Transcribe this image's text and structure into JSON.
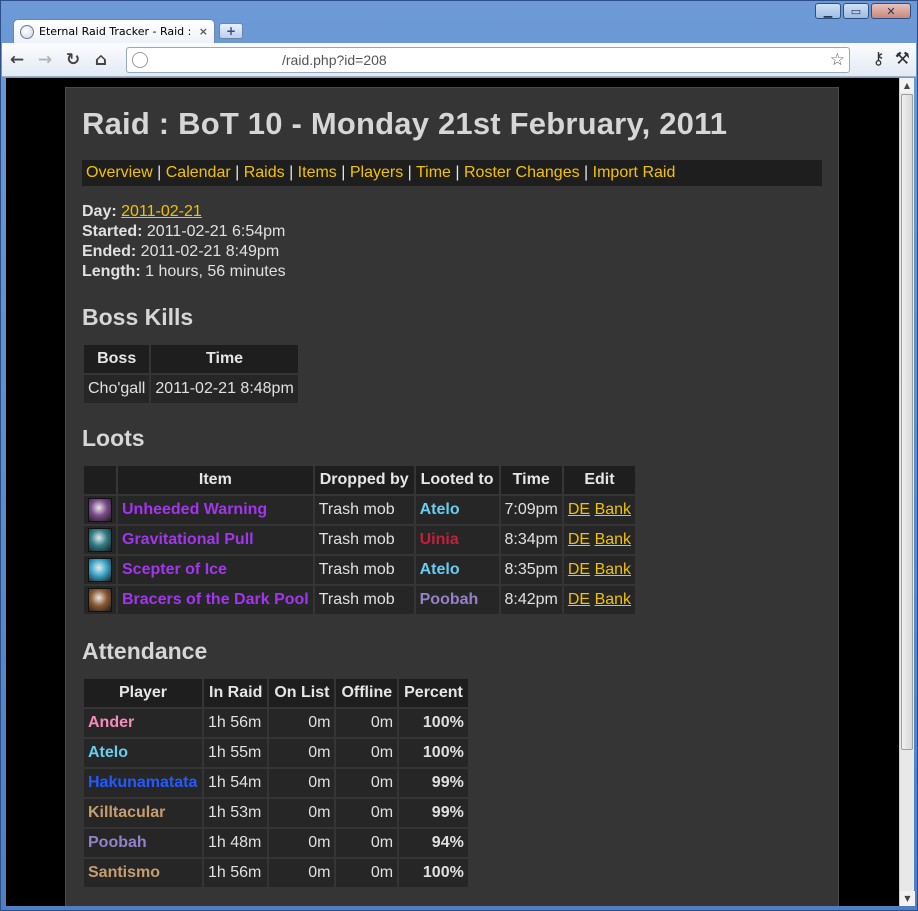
{
  "browser": {
    "tab_title": "Eternal Raid Tracker - Raid : BoT",
    "tab_close": "×",
    "new_tab": "+",
    "url": "/raid.php?id=208",
    "window_controls": [
      "▁",
      "▭",
      "✕"
    ]
  },
  "page": {
    "title": "Raid : BoT 10 - Monday 21st February, 2011",
    "nav": [
      "Overview",
      "Calendar",
      "Raids",
      "Items",
      "Players",
      "Time",
      "Roster Changes",
      "Import Raid"
    ],
    "info": {
      "day_label": "Day:",
      "day_value": "2011-02-21",
      "started_label": "Started:",
      "started_value": "2011-02-21 6:54pm",
      "ended_label": "Ended:",
      "ended_value": "2011-02-21 8:49pm",
      "length_label": "Length:",
      "length_value": "1 hours, 56 minutes"
    },
    "boss_kills": {
      "heading": "Boss Kills",
      "headers": [
        "Boss",
        "Time"
      ],
      "rows": [
        {
          "boss": "Cho'gall",
          "time": "2011-02-21 8:48pm"
        }
      ]
    },
    "loots": {
      "heading": "Loots",
      "headers": [
        "Item",
        "Dropped by",
        "Looted to",
        "Time",
        "Edit"
      ],
      "rows": [
        {
          "icon": "warning-icon",
          "icon_color": "#7a4a8a",
          "item": "Unheeded Warning",
          "dropped_by": "Trash mob",
          "looted_to": "Atelo",
          "looter_color": "#69ccf0",
          "time": "7:09pm",
          "de": "DE",
          "bank": "Bank"
        },
        {
          "icon": "pull-icon",
          "icon_color": "#2f7d86",
          "item": "Gravitational Pull",
          "dropped_by": "Trash mob",
          "looted_to": "Uinia",
          "looter_color": "#c41f3b",
          "time": "8:34pm",
          "de": "DE",
          "bank": "Bank"
        },
        {
          "icon": "scepter-icon",
          "icon_color": "#3aa6c9",
          "item": "Scepter of Ice",
          "dropped_by": "Trash mob",
          "looted_to": "Atelo",
          "looter_color": "#69ccf0",
          "time": "8:35pm",
          "de": "DE",
          "bank": "Bank"
        },
        {
          "icon": "bracers-icon",
          "icon_color": "#8a5a34",
          "item": "Bracers of the Dark Pool",
          "dropped_by": "Trash mob",
          "looted_to": "Poobah",
          "looter_color": "#9482c9",
          "time": "8:42pm",
          "de": "DE",
          "bank": "Bank"
        }
      ],
      "item_color": "#a335ee"
    },
    "attendance": {
      "heading": "Attendance",
      "headers": [
        "Player",
        "In Raid",
        "On List",
        "Offline",
        "Percent"
      ],
      "rows": [
        {
          "player": "Ander",
          "color": "#f58cba",
          "in_raid": "1h 56m",
          "on_list": "0m",
          "offline": "0m",
          "percent": "100%"
        },
        {
          "player": "Atelo",
          "color": "#69ccf0",
          "in_raid": "1h 55m",
          "on_list": "0m",
          "offline": "0m",
          "percent": "100%"
        },
        {
          "player": "Hakunamatata",
          "color": "#2459ff",
          "in_raid": "1h 54m",
          "on_list": "0m",
          "offline": "0m",
          "percent": "99%"
        },
        {
          "player": "Killtacular",
          "color": "#c79c6e",
          "in_raid": "1h 53m",
          "on_list": "0m",
          "offline": "0m",
          "percent": "99%"
        },
        {
          "player": "Poobah",
          "color": "#9482c9",
          "in_raid": "1h 48m",
          "on_list": "0m",
          "offline": "0m",
          "percent": "94%"
        },
        {
          "player": "Santismo",
          "color": "#c79c6e",
          "in_raid": "1h 56m",
          "on_list": "0m",
          "offline": "0m",
          "percent": "100%"
        }
      ]
    }
  }
}
